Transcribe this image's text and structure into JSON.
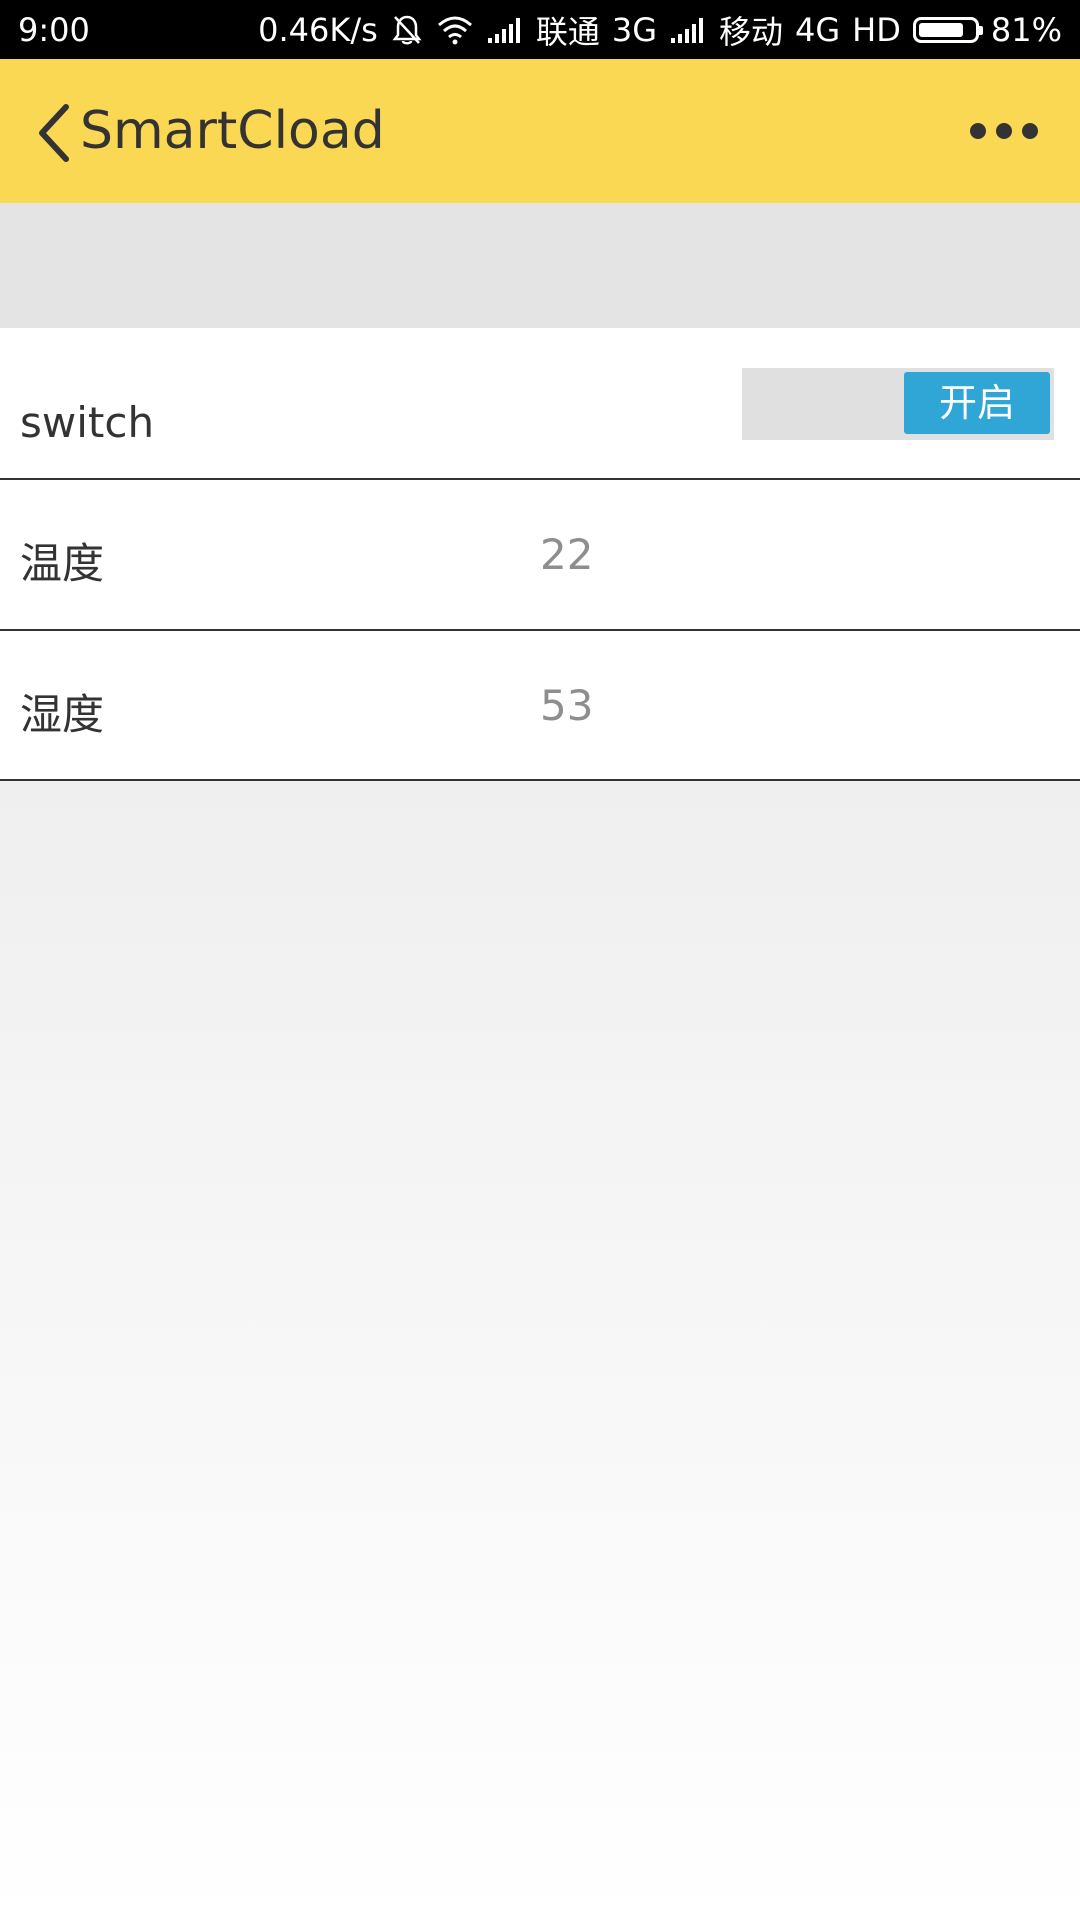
{
  "status_bar": {
    "time": "9:00",
    "net_speed": "0.46K/s",
    "carrier1": "联通",
    "net1": "3G",
    "carrier2": "移动",
    "net2": "4G",
    "hd": "HD",
    "battery_percent": "81%",
    "battery_level": 0.81,
    "icons": [
      "bell-off-icon",
      "wifi-icon",
      "signal-icon",
      "signal-icon",
      "battery-icon"
    ]
  },
  "app_bar": {
    "title": "SmartCload",
    "back_icon": "chevron-left-icon",
    "more_icon": "more-horizontal-icon"
  },
  "rows": [
    {
      "label": "switch",
      "toggle_label": "开启",
      "toggle_on": true
    },
    {
      "label": "温度",
      "value": "22"
    },
    {
      "label": "湿度",
      "value": "53"
    }
  ],
  "colors": {
    "app_bar": "#fbd854",
    "toggle_on": "#2fa6d6",
    "spacer": "#e4e4e4"
  }
}
